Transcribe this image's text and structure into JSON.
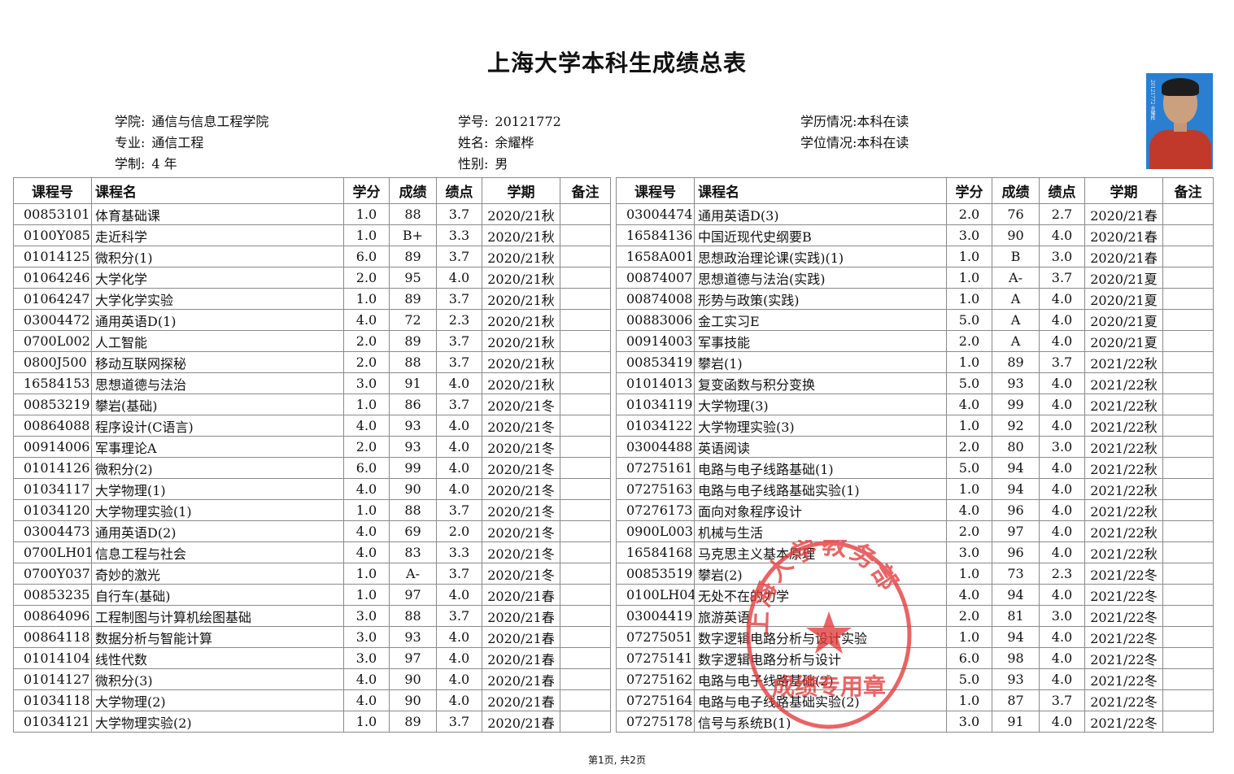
{
  "title": "上海大学本科生成绩总表",
  "info": {
    "college_label": "学院:",
    "college": "通信与信息工程学院",
    "major_label": "专业:",
    "major": "通信工程",
    "length_label": "学制:",
    "length": "4 年",
    "id_label": "学号:",
    "id": "20121772",
    "name_label": "姓名:",
    "name": "余耀桦",
    "gender_label": "性别:",
    "gender": "男",
    "edu_label": "学历情况:",
    "edu": "本科在读",
    "degree_label": "学位情况:",
    "degree": "本科在读"
  },
  "photo_caption": "20121772 余耀桦",
  "columns": [
    "课程号",
    "课程名",
    "学分",
    "成绩",
    "绩点",
    "学期",
    "备注"
  ],
  "left_rows": [
    [
      "00853101",
      "体育基础课",
      "1.0",
      "88",
      "3.7",
      "2020/21秋",
      ""
    ],
    [
      "0100Y085",
      "走近科学",
      "1.0",
      "B+",
      "3.3",
      "2020/21秋",
      ""
    ],
    [
      "01014125",
      "微积分(1)",
      "6.0",
      "89",
      "3.7",
      "2020/21秋",
      ""
    ],
    [
      "01064246",
      "大学化学",
      "2.0",
      "95",
      "4.0",
      "2020/21秋",
      ""
    ],
    [
      "01064247",
      "大学化学实验",
      "1.0",
      "89",
      "3.7",
      "2020/21秋",
      ""
    ],
    [
      "03004472",
      "通用英语D(1)",
      "4.0",
      "72",
      "2.3",
      "2020/21秋",
      ""
    ],
    [
      "0700L002",
      "人工智能",
      "2.0",
      "89",
      "3.7",
      "2020/21秋",
      ""
    ],
    [
      "0800J500",
      "移动互联网探秘",
      "2.0",
      "88",
      "3.7",
      "2020/21秋",
      ""
    ],
    [
      "16584153",
      "思想道德与法治",
      "3.0",
      "91",
      "4.0",
      "2020/21秋",
      ""
    ],
    [
      "00853219",
      "攀岩(基础)",
      "1.0",
      "86",
      "3.7",
      "2020/21冬",
      ""
    ],
    [
      "00864088",
      "程序设计(C语言)",
      "4.0",
      "93",
      "4.0",
      "2020/21冬",
      ""
    ],
    [
      "00914006",
      "军事理论A",
      "2.0",
      "93",
      "4.0",
      "2020/21冬",
      ""
    ],
    [
      "01014126",
      "微积分(2)",
      "6.0",
      "99",
      "4.0",
      "2020/21冬",
      ""
    ],
    [
      "01034117",
      "大学物理(1)",
      "4.0",
      "90",
      "4.0",
      "2020/21冬",
      ""
    ],
    [
      "01034120",
      "大学物理实验(1)",
      "1.0",
      "88",
      "3.7",
      "2020/21冬",
      ""
    ],
    [
      "03004473",
      "通用英语D(2)",
      "4.0",
      "69",
      "2.0",
      "2020/21冬",
      ""
    ],
    [
      "0700LH01",
      "信息工程与社会",
      "4.0",
      "83",
      "3.3",
      "2020/21冬",
      ""
    ],
    [
      "0700Y037",
      "奇妙的激光",
      "1.0",
      "A-",
      "3.7",
      "2020/21冬",
      ""
    ],
    [
      "00853235",
      "自行车(基础)",
      "1.0",
      "97",
      "4.0",
      "2020/21春",
      ""
    ],
    [
      "00864096",
      "工程制图与计算机绘图基础",
      "3.0",
      "88",
      "3.7",
      "2020/21春",
      ""
    ],
    [
      "00864118",
      "数据分析与智能计算",
      "3.0",
      "93",
      "4.0",
      "2020/21春",
      ""
    ],
    [
      "01014104",
      "线性代数",
      "3.0",
      "97",
      "4.0",
      "2020/21春",
      ""
    ],
    [
      "01014127",
      "微积分(3)",
      "4.0",
      "90",
      "4.0",
      "2020/21春",
      ""
    ],
    [
      "01034118",
      "大学物理(2)",
      "4.0",
      "90",
      "4.0",
      "2020/21春",
      ""
    ],
    [
      "01034121",
      "大学物理实验(2)",
      "1.0",
      "89",
      "3.7",
      "2020/21春",
      ""
    ]
  ],
  "right_rows": [
    [
      "03004474",
      "通用英语D(3)",
      "2.0",
      "76",
      "2.7",
      "2020/21春",
      ""
    ],
    [
      "16584136",
      "中国近现代史纲要B",
      "3.0",
      "90",
      "4.0",
      "2020/21春",
      ""
    ],
    [
      "1658A001",
      "思想政治理论课(实践)(1)",
      "1.0",
      "B",
      "3.0",
      "2020/21春",
      ""
    ],
    [
      "00874007",
      "思想道德与法治(实践)",
      "1.0",
      "A-",
      "3.7",
      "2020/21夏",
      ""
    ],
    [
      "00874008",
      "形势与政策(实践)",
      "1.0",
      "A",
      "4.0",
      "2020/21夏",
      ""
    ],
    [
      "00883006",
      "金工实习E",
      "5.0",
      "A",
      "4.0",
      "2020/21夏",
      ""
    ],
    [
      "00914003",
      "军事技能",
      "2.0",
      "A",
      "4.0",
      "2020/21夏",
      ""
    ],
    [
      "00853419",
      "攀岩(1)",
      "1.0",
      "89",
      "3.7",
      "2021/22秋",
      ""
    ],
    [
      "01014013",
      "复变函数与积分变换",
      "5.0",
      "93",
      "4.0",
      "2021/22秋",
      ""
    ],
    [
      "01034119",
      "大学物理(3)",
      "4.0",
      "99",
      "4.0",
      "2021/22秋",
      ""
    ],
    [
      "01034122",
      "大学物理实验(3)",
      "1.0",
      "92",
      "4.0",
      "2021/22秋",
      ""
    ],
    [
      "03004488",
      "英语阅读",
      "2.0",
      "80",
      "3.0",
      "2021/22秋",
      ""
    ],
    [
      "07275161",
      "电路与电子线路基础(1)",
      "5.0",
      "94",
      "4.0",
      "2021/22秋",
      ""
    ],
    [
      "07275163",
      "电路与电子线路基础实验(1)",
      "1.0",
      "94",
      "4.0",
      "2021/22秋",
      ""
    ],
    [
      "07276173",
      "面向对象程序设计",
      "4.0",
      "96",
      "4.0",
      "2021/22秋",
      ""
    ],
    [
      "0900L003",
      "机械与生活",
      "2.0",
      "97",
      "4.0",
      "2021/22秋",
      ""
    ],
    [
      "16584168",
      "马克思主义基本原理",
      "3.0",
      "96",
      "4.0",
      "2021/22秋",
      ""
    ],
    [
      "00853519",
      "攀岩(2)",
      "1.0",
      "73",
      "2.3",
      "2021/22冬",
      ""
    ],
    [
      "0100LH04",
      "无处不在的力学",
      "4.0",
      "94",
      "4.0",
      "2021/22冬",
      ""
    ],
    [
      "03004419",
      "旅游英语",
      "2.0",
      "81",
      "3.0",
      "2021/22冬",
      ""
    ],
    [
      "07275051",
      "数字逻辑电路分析与设计实验",
      "1.0",
      "94",
      "4.0",
      "2021/22冬",
      ""
    ],
    [
      "07275141",
      "数字逻辑电路分析与设计",
      "6.0",
      "98",
      "4.0",
      "2021/22冬",
      ""
    ],
    [
      "07275162",
      "电路与电子线路基础(2)",
      "5.0",
      "93",
      "4.0",
      "2021/22冬",
      ""
    ],
    [
      "07275164",
      "电路与电子线路基础实验(2)",
      "1.0",
      "87",
      "3.7",
      "2021/22冬",
      ""
    ],
    [
      "07275178",
      "信号与系统B(1)",
      "3.0",
      "91",
      "4.0",
      "2021/22冬",
      ""
    ]
  ],
  "stamp": {
    "top_text": "上海大学教务部",
    "bottom_text": "成绩专用章",
    "color": "#e23a3a"
  },
  "footer": "第1页, 共2页"
}
